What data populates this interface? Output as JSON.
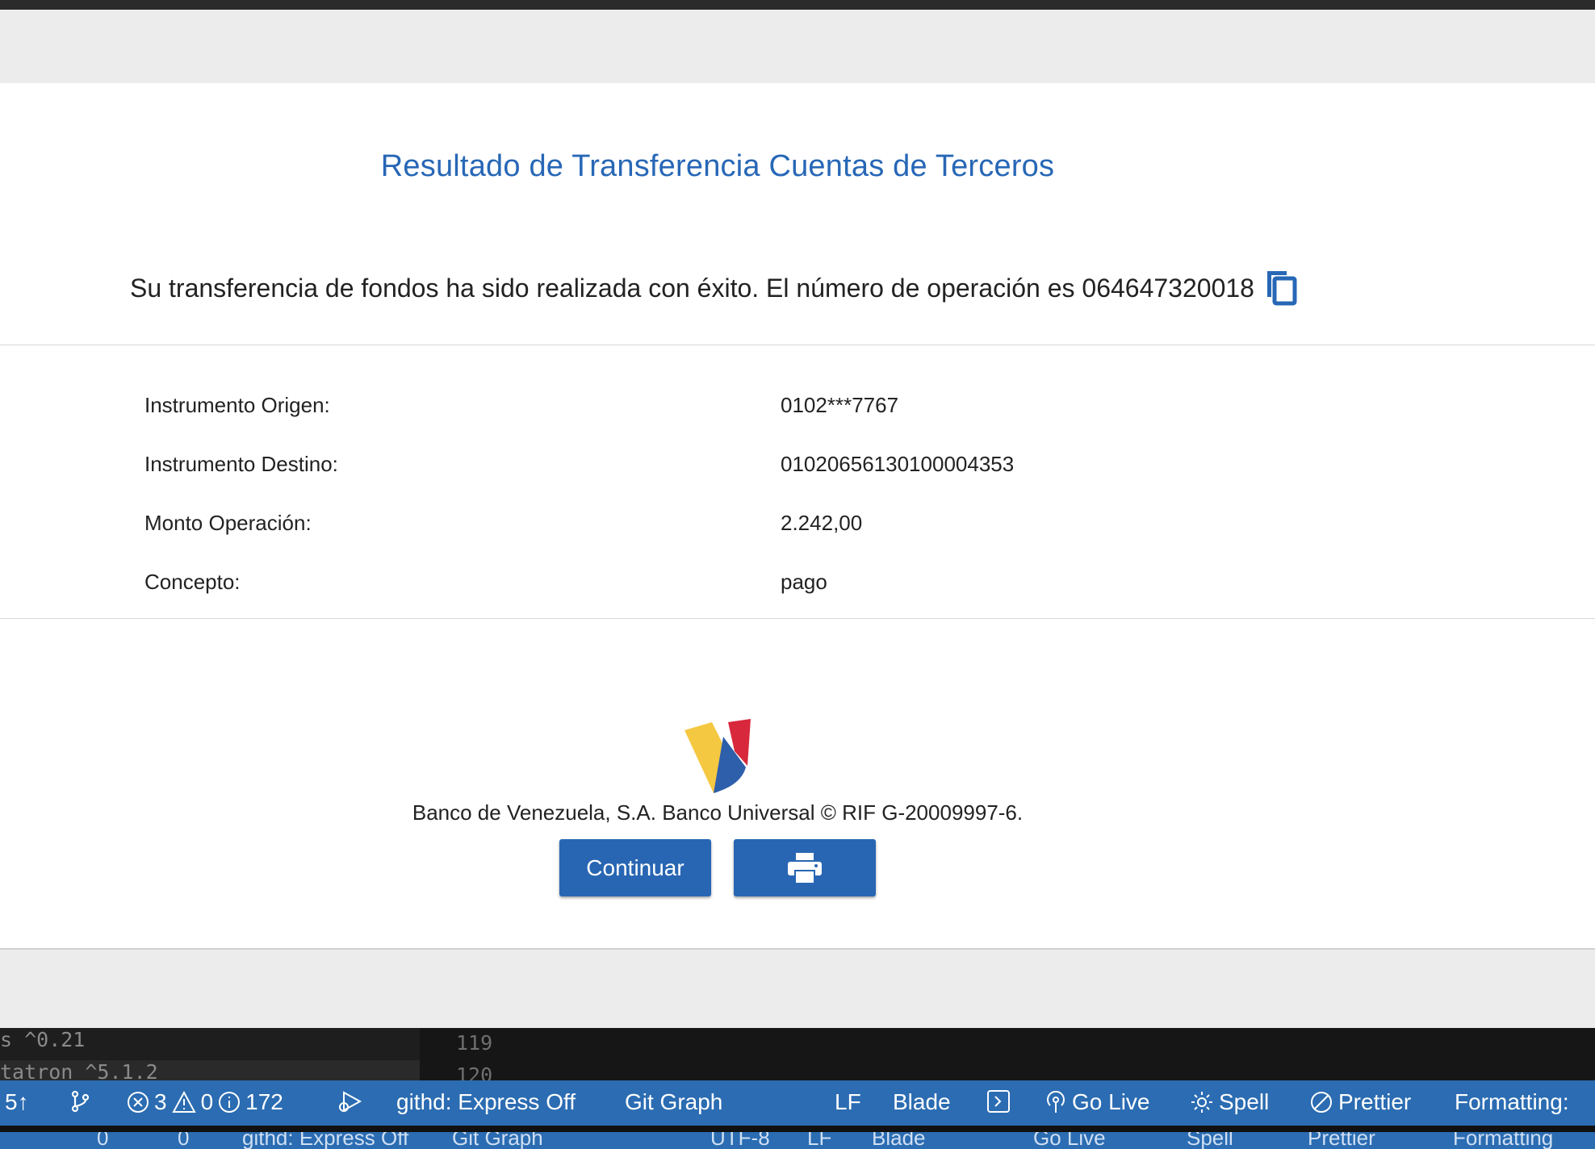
{
  "page": {
    "title": "Resultado de Transferencia Cuentas de Terceros",
    "success_message": "Su transferencia de fondos ha sido realizada con éxito. El número de operación es 064647320018"
  },
  "details": [
    {
      "label": "Instrumento Origen:",
      "value": "0102***7767"
    },
    {
      "label": "Instrumento Destino:",
      "value": "01020656130100004353"
    },
    {
      "label": "Monto Operación:",
      "value": "2.242,00"
    },
    {
      "label": "Concepto:",
      "value": "pago"
    }
  ],
  "footer": {
    "text": "Banco de Venezuela, S.A. Banco Universal © RIF G-20009997-6.",
    "continue_label": "Continuar",
    "print_icon": "printer-icon"
  },
  "editor": {
    "side_item1": "s ^0.21",
    "side_item2": "tatron ^5.1.2",
    "line_numbers": [
      "119",
      "120"
    ]
  },
  "statusbar": {
    "sync": "5↑",
    "errors": "3",
    "warnings": "0",
    "infos": "172",
    "githd": "githd: Express Off",
    "git_graph": "Git Graph",
    "eol": "LF",
    "language": "Blade",
    "go_live": "Go Live",
    "spell": "Spell",
    "prettier": "Prettier",
    "formatting": "Formatting: "
  },
  "statusbar2": {
    "items": [
      "0",
      "0",
      "githd: Express Off",
      "Git Graph",
      "UTF-8",
      "LF",
      "Blade",
      "Go Live",
      "Spell",
      "Prettier",
      "Formatting"
    ]
  },
  "colors": {
    "accent": "#2767b6",
    "button": "#2866b3",
    "statusbar": "#2b6cb2",
    "logo_yellow": "#f5c842",
    "logo_red": "#d8283c",
    "logo_blue": "#2d5faa"
  }
}
